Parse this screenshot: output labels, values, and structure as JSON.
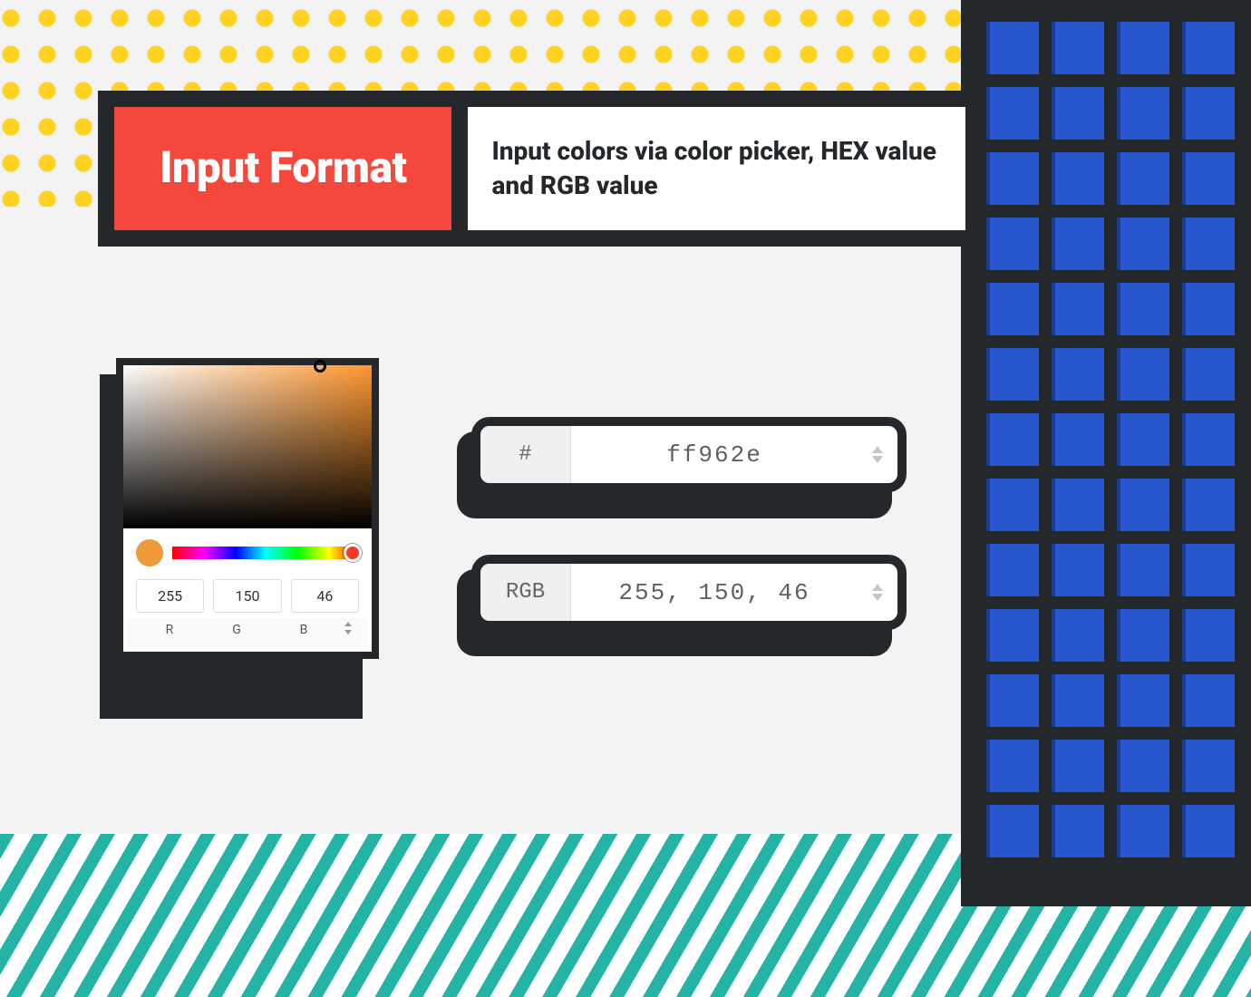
{
  "header": {
    "title": "Input Format",
    "subtitle": "Input colors via color picker, HEX value and RGB value"
  },
  "picker": {
    "selected_hex": "ff962e",
    "swatch_color": "#ed9a3a",
    "rgb": {
      "r": "255",
      "g": "150",
      "b": "46"
    },
    "labels": {
      "r": "R",
      "g": "G",
      "b": "B"
    }
  },
  "hex_field": {
    "prefix": "#",
    "value": "ff962e"
  },
  "rgb_field": {
    "prefix": "RGB",
    "value": "255, 150, 46"
  }
}
